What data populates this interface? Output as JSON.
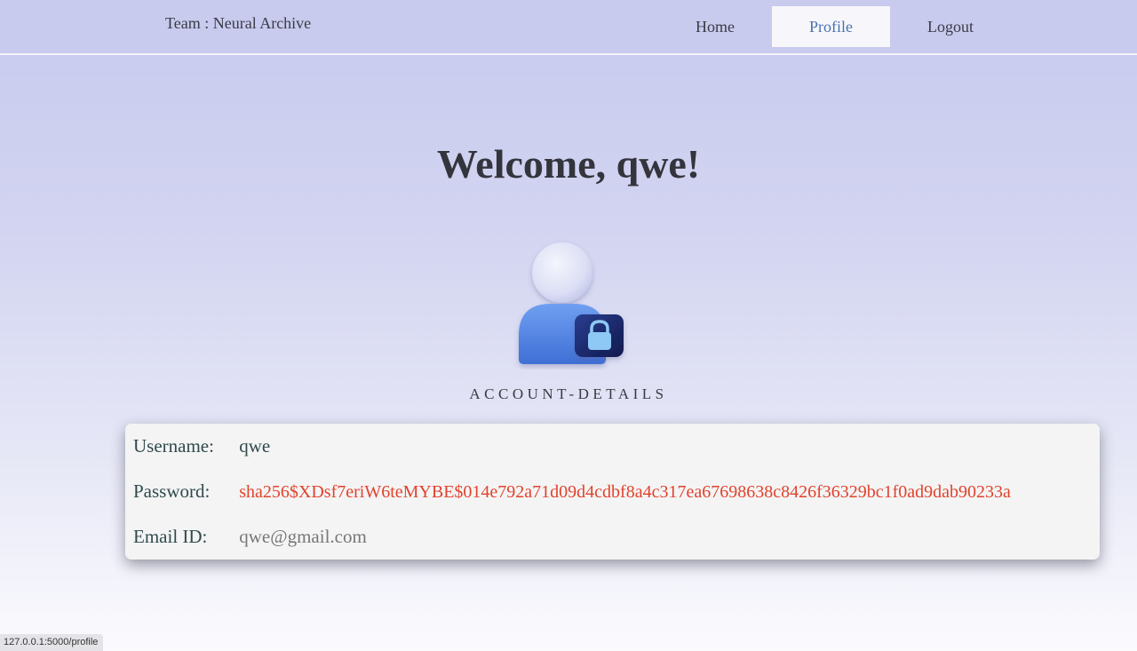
{
  "header": {
    "brand": "Team : Neural Archive",
    "nav": [
      {
        "label": "Home",
        "active": false
      },
      {
        "label": "Profile",
        "active": true
      },
      {
        "label": "Logout",
        "active": false
      }
    ]
  },
  "main": {
    "welcome": "Welcome, qwe!",
    "avatar_icon": "user-lock-icon",
    "section_label": "ACCOUNT-DETAILS",
    "details": [
      {
        "label": "Username:",
        "value": "qwe"
      },
      {
        "label": "Password:",
        "value": "sha256$XDsf7eriW6teMYBE$014e792a71d09d4cdbf8a4c317ea67698638c8426f36329bc1f0ad9dab90233a"
      },
      {
        "label": "Email ID:",
        "value": "qwe@gmail.com"
      }
    ]
  },
  "status_url": "127.0.0.1:5000/profile",
  "colors": {
    "header_bg": "#c8caee",
    "active_tab_text": "#4a72b0",
    "password_text": "#e2422c",
    "label_text": "#2f4a4c"
  }
}
